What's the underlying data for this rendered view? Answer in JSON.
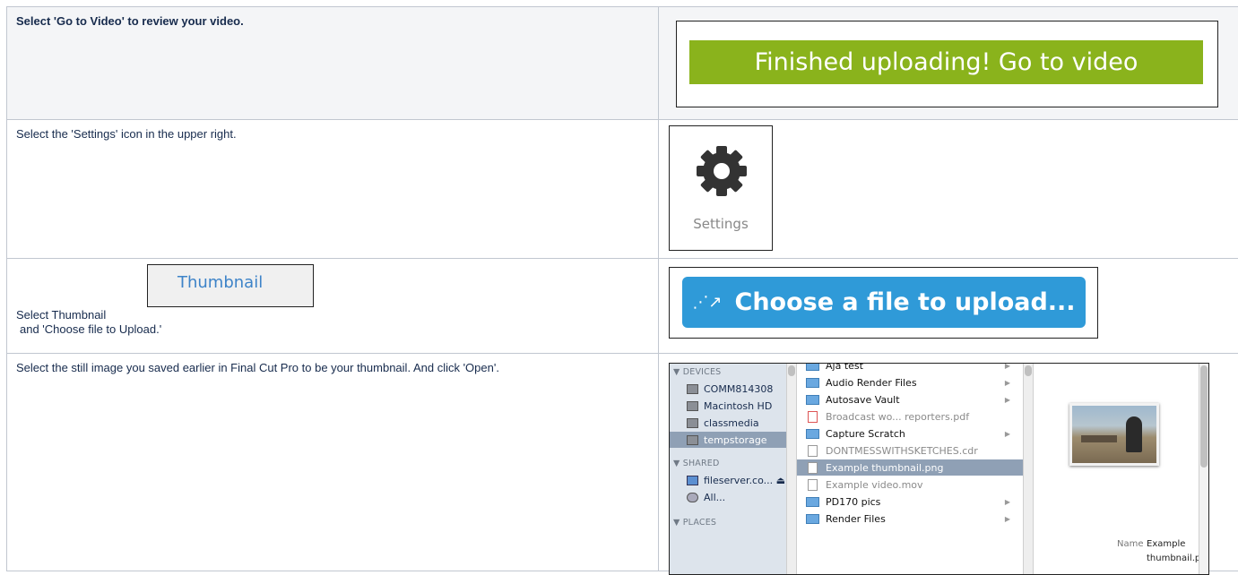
{
  "rows": [
    {
      "instruction": "Select 'Go to Video' to review your video.",
      "button_label": "Finished uploading! Go to video",
      "button_color": "#8ab31c"
    },
    {
      "instruction": "Select the 'Settings' icon in the upper right.",
      "icon_label": "Settings"
    },
    {
      "instruction_part1": "Select Thumbnail",
      "tab_label": "Thumbnail",
      "instruction_part2": "and 'Choose file to Upload.'",
      "button_label": "Choose a file to upload...",
      "button_color": "#2f9ad8"
    },
    {
      "instruction": "Select the still image you saved earlier in Final Cut Pro to be your thumbnail. And click 'Open'."
    }
  ],
  "dialog": {
    "sidebar": {
      "devices_header": "▼ DEVICES",
      "devices": [
        "COMM814308",
        "Macintosh HD",
        "classmedia",
        "tempstorage"
      ],
      "shared_header": "▼ SHARED",
      "shared": [
        "fileserver.co...  ⏏",
        "All..."
      ],
      "places_header": "▼ PLACES"
    },
    "files": [
      "Aja test",
      "Audio Render Files",
      "Autosave Vault",
      "Broadcast wo... reporters.pdf",
      "Capture Scratch",
      "DONTMESSWITHSKETCHES.cdr",
      "Example thumbnail.png",
      "Example video.mov",
      "PD170 pics",
      "Render Files"
    ],
    "preview": {
      "name_key": "Name",
      "name_value_line1": "Example",
      "name_value_line2": "thumbnail.png"
    }
  }
}
